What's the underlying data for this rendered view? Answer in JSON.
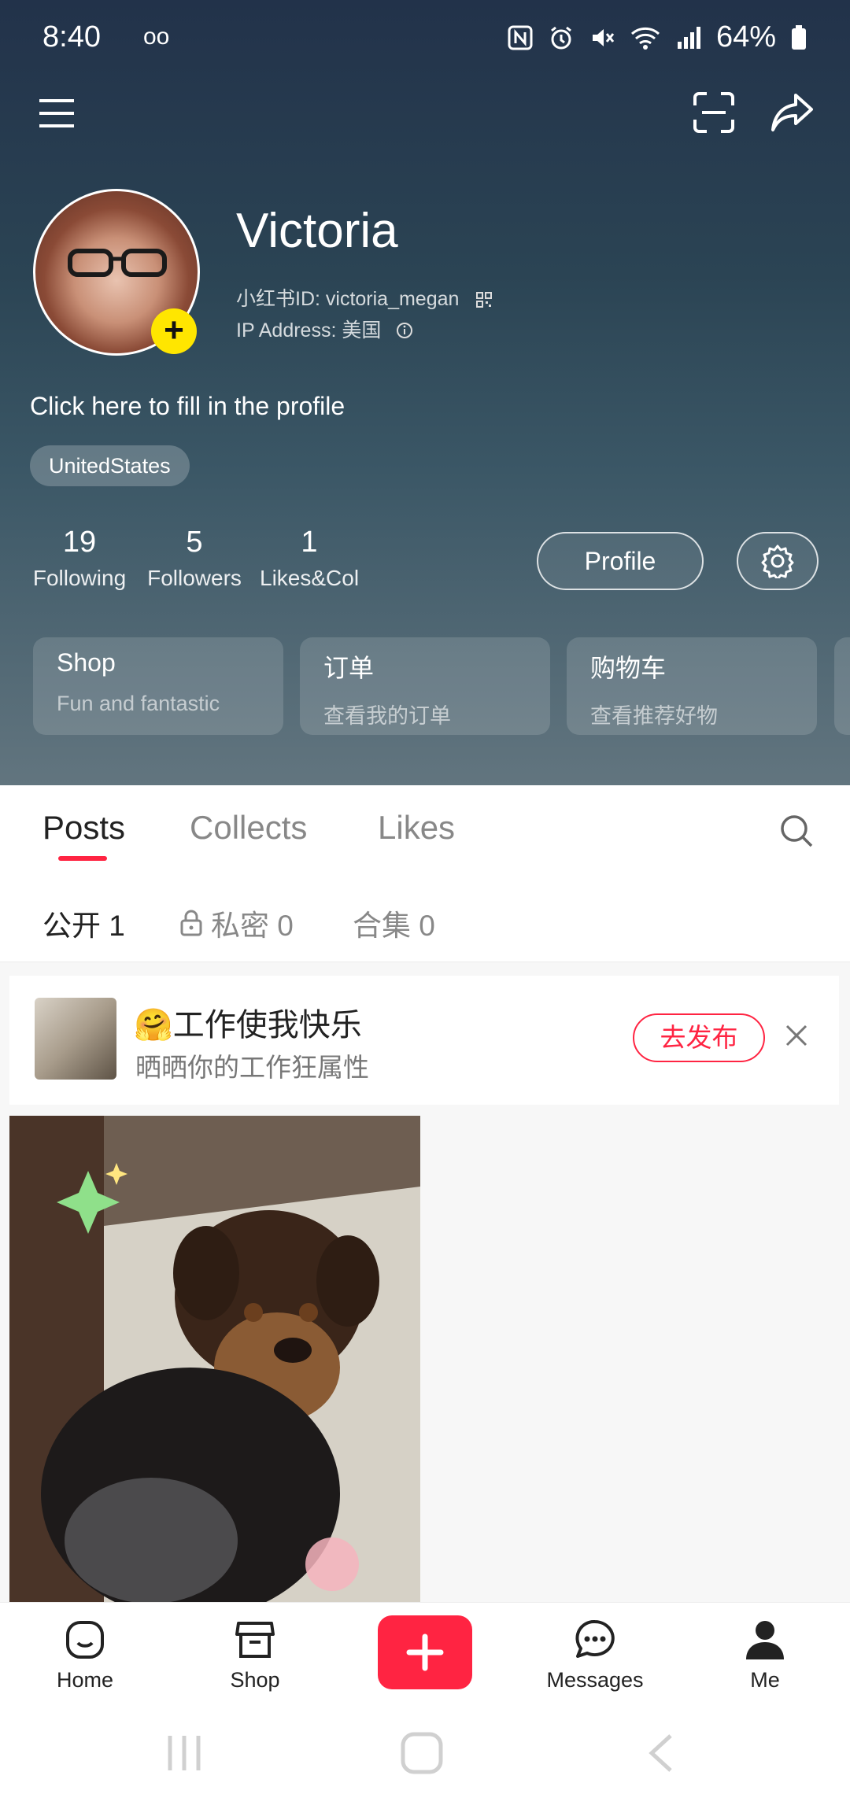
{
  "status_bar": {
    "time": "8:40",
    "voicemail": "oo",
    "battery": "64%"
  },
  "profile": {
    "name": "Victoria",
    "id_line": "小红书ID: victoria_megan",
    "ip_line": "IP Address: 美国",
    "bio_prompt": "Click here to fill in the profile",
    "tag": "UnitedStates",
    "add_badge": "+"
  },
  "stats": [
    {
      "num": "19",
      "label": "Following"
    },
    {
      "num": "5",
      "label": "Followers"
    },
    {
      "num": "1",
      "label": "Likes&Col"
    }
  ],
  "buttons": {
    "profile": "Profile"
  },
  "cards": [
    {
      "title": "Shop",
      "sub": "Fun and fantastic"
    },
    {
      "title": "订单",
      "sub": "查看我的订单"
    },
    {
      "title": "购物车",
      "sub": "查看推荐好物"
    }
  ],
  "tabs": [
    {
      "label": "Posts"
    },
    {
      "label": "Collects"
    },
    {
      "label": "Likes"
    }
  ],
  "subtabs": [
    {
      "label": "公开 1"
    },
    {
      "label": "私密 0"
    },
    {
      "label": "合集 0"
    }
  ],
  "banner": {
    "title": "🤗工作使我快乐",
    "subtitle": "晒晒你的工作狂属性",
    "button": "去发布"
  },
  "bottom_nav": {
    "home": "Home",
    "shop": "Shop",
    "messages": "Messages",
    "me": "Me"
  },
  "colors": {
    "accent": "#ff2442",
    "badge": "#ffe600"
  }
}
